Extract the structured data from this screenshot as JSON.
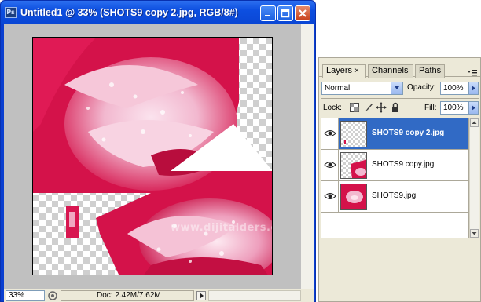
{
  "document": {
    "app_icon": "Ps",
    "title": "Untitled1 @ 33% (SHOTS9 copy 2.jpg, RGB/8#)",
    "watermark": "www.dijitalders.com",
    "status": {
      "zoom": "33%",
      "doc_size": "Doc: 2.42M/7.62M"
    }
  },
  "layers_panel": {
    "tabs": [
      {
        "label": "Layers",
        "close": "×"
      },
      {
        "label": "Channels"
      },
      {
        "label": "Paths"
      }
    ],
    "blend_mode": "Normal",
    "opacity_label": "Opacity:",
    "opacity_value": "100%",
    "lock_label": "Lock:",
    "fill_label": "Fill:",
    "fill_value": "100%",
    "layers": [
      {
        "name": "SHOTS9 copy 2.jpg",
        "selected": true,
        "visible": true
      },
      {
        "name": "SHOTS9 copy.jpg",
        "selected": false,
        "visible": true
      },
      {
        "name": "SHOTS9.jpg",
        "selected": false,
        "visible": true
      }
    ]
  },
  "colors": {
    "titlebar": "#0a46d4",
    "selection": "#316ac5",
    "rose_red": "#d4124a",
    "rose_pink": "#f2b8cf"
  },
  "icons": [
    "photoshop-icon",
    "minimize-icon",
    "maximize-icon",
    "close-icon",
    "eye-icon",
    "chevron-down-icon",
    "lock-transparency-icon",
    "lock-brush-icon",
    "lock-move-icon",
    "lock-all-icon",
    "panel-menu-icon"
  ]
}
